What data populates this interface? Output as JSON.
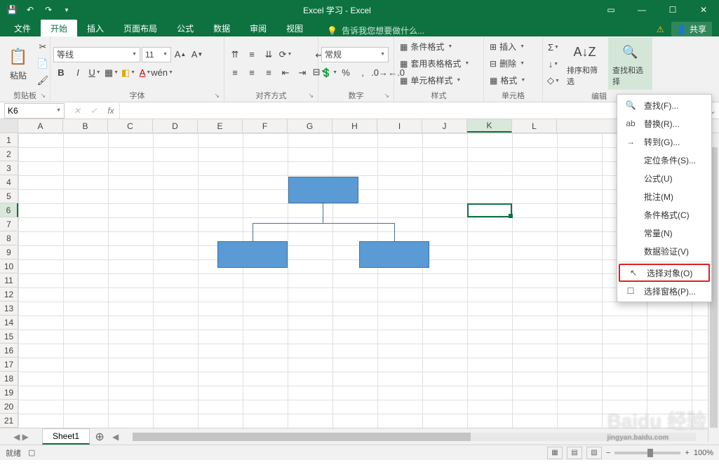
{
  "title": "Excel 学习 - Excel",
  "tabs": {
    "file": "文件",
    "home": "开始",
    "insert": "插入",
    "layout": "页面布局",
    "formulas": "公式",
    "data": "数据",
    "review": "审阅",
    "view": "视图"
  },
  "tell_me": "告诉我您想要做什么...",
  "share": "共享",
  "groups": {
    "clipboard": "剪贴板",
    "font": "字体",
    "alignment": "对齐方式",
    "number": "数字",
    "styles": "样式",
    "cells": "单元格",
    "editing": "编辑"
  },
  "clipboard": {
    "paste": "粘贴"
  },
  "font": {
    "name": "等线",
    "size": "11"
  },
  "number": {
    "format": "常规"
  },
  "styles": {
    "conditional": "条件格式",
    "table": "套用表格格式",
    "cell": "单元格样式"
  },
  "cells": {
    "insert": "插入",
    "delete": "删除",
    "format": "格式"
  },
  "editing": {
    "sort": "排序和筛选",
    "find": "查找和选择"
  },
  "namebox": "K6",
  "columns": [
    "A",
    "B",
    "C",
    "D",
    "E",
    "F",
    "G",
    "H",
    "I",
    "J",
    "K",
    "L"
  ],
  "rows": [
    "1",
    "2",
    "3",
    "4",
    "5",
    "6",
    "7",
    "8",
    "9",
    "10",
    "11",
    "12",
    "13",
    "14",
    "15",
    "16",
    "17",
    "18",
    "19",
    "20",
    "21"
  ],
  "sheet": {
    "name": "Sheet1"
  },
  "status": {
    "ready": "就绪",
    "zoom": "100%"
  },
  "dropdown": {
    "find": "查找(F)...",
    "replace": "替换(R)...",
    "goto": "转到(G)...",
    "special": "定位条件(S)...",
    "formulas": "公式(U)",
    "comments": "批注(M)",
    "cond": "条件格式(C)",
    "constants": "常量(N)",
    "validation": "数据验证(V)",
    "objects": "选择对象(O)",
    "pane": "选择窗格(P)..."
  },
  "watermark": "Baidu 经验",
  "watermark_sub": "jingyan.baidu.com"
}
